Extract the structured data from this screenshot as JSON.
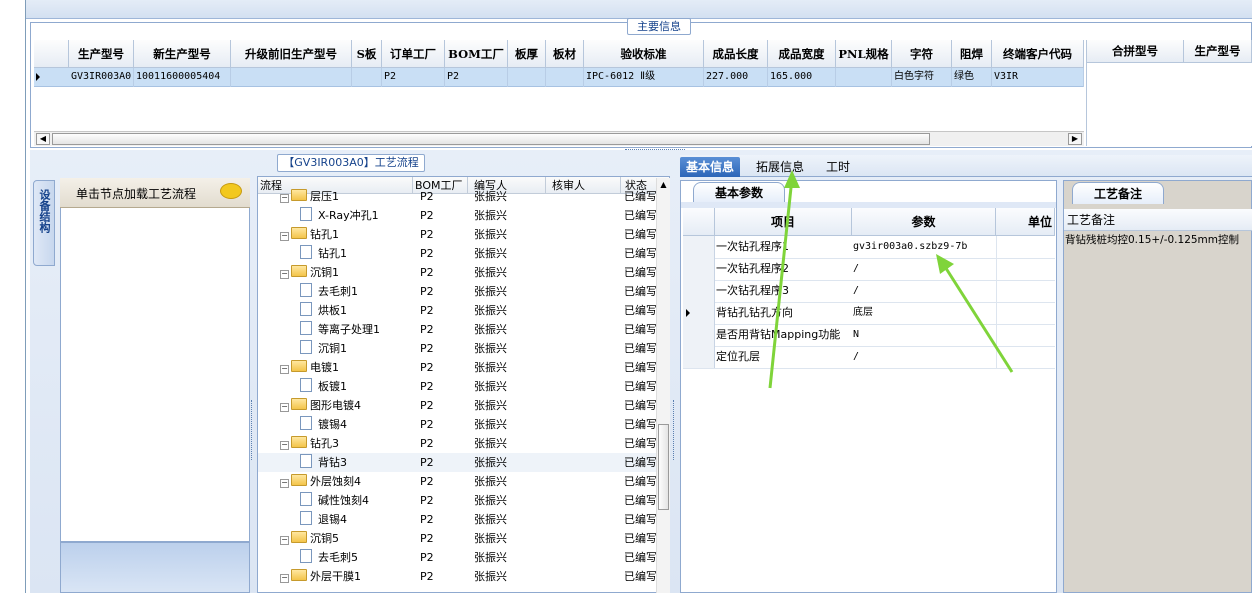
{
  "top": {
    "section_title": "主要信息",
    "columns": [
      "生产型号",
      "新生产型号",
      "升级前旧生产型号",
      "S板",
      "订单工厂",
      "BOM工厂",
      "板厚",
      "板材",
      "验收标准",
      "成品长度",
      "成品宽度",
      "PNL规格",
      "字符",
      "阻焊",
      "终端客户代码"
    ],
    "row": [
      "GV3IR003A0",
      "10011600005404",
      "",
      "",
      "P2",
      "P2",
      "",
      "",
      "IPC-6012 Ⅱ级",
      "227.000",
      "165.000",
      "",
      "白色字符",
      "绿色",
      "V3IR"
    ],
    "right_columns": [
      "合拼型号",
      "生产型号"
    ]
  },
  "process": {
    "title": "【GV3IR003A0】工艺流程",
    "vertical_tab": "设备结构",
    "nav_hint": "单击节点加载工艺流程",
    "columns": [
      "流程",
      "BOM工厂",
      "编写人",
      "核审人",
      "状态"
    ],
    "rows": [
      {
        "name": "层压1",
        "level": 0,
        "factory": "P2",
        "writer": "张振兴",
        "reviewer": "",
        "status": "已编写"
      },
      {
        "name": "X-Ray冲孔1",
        "level": 1,
        "factory": "P2",
        "writer": "张振兴",
        "reviewer": "",
        "status": "已编写"
      },
      {
        "name": "钻孔1",
        "level": 0,
        "factory": "P2",
        "writer": "张振兴",
        "reviewer": "",
        "status": "已编写"
      },
      {
        "name": "钻孔1",
        "level": 1,
        "factory": "P2",
        "writer": "张振兴",
        "reviewer": "",
        "status": "已编写"
      },
      {
        "name": "沉铜1",
        "level": 0,
        "factory": "P2",
        "writer": "张振兴",
        "reviewer": "",
        "status": "已编写"
      },
      {
        "name": "去毛刺1",
        "level": 1,
        "factory": "P2",
        "writer": "张振兴",
        "reviewer": "",
        "status": "已编写"
      },
      {
        "name": "烘板1",
        "level": 1,
        "factory": "P2",
        "writer": "张振兴",
        "reviewer": "",
        "status": "已编写"
      },
      {
        "name": "等离子处理1",
        "level": 1,
        "factory": "P2",
        "writer": "张振兴",
        "reviewer": "",
        "status": "已编写"
      },
      {
        "name": "沉铜1",
        "level": 1,
        "factory": "P2",
        "writer": "张振兴",
        "reviewer": "",
        "status": "已编写"
      },
      {
        "name": "电镀1",
        "level": 0,
        "factory": "P2",
        "writer": "张振兴",
        "reviewer": "",
        "status": "已编写"
      },
      {
        "name": "板镀1",
        "level": 1,
        "factory": "P2",
        "writer": "张振兴",
        "reviewer": "",
        "status": "已编写"
      },
      {
        "name": "图形电镀4",
        "level": 0,
        "factory": "P2",
        "writer": "张振兴",
        "reviewer": "",
        "status": "已编写"
      },
      {
        "name": "镀锡4",
        "level": 1,
        "factory": "P2",
        "writer": "张振兴",
        "reviewer": "",
        "status": "已编写"
      },
      {
        "name": "钻孔3",
        "level": 0,
        "factory": "P2",
        "writer": "张振兴",
        "reviewer": "",
        "status": "已编写"
      },
      {
        "name": "背钻3",
        "level": 1,
        "factory": "P2",
        "writer": "张振兴",
        "reviewer": "",
        "status": "已编写"
      },
      {
        "name": "外层蚀刻4",
        "level": 0,
        "factory": "P2",
        "writer": "张振兴",
        "reviewer": "",
        "status": "已编写"
      },
      {
        "name": "碱性蚀刻4",
        "level": 1,
        "factory": "P2",
        "writer": "张振兴",
        "reviewer": "",
        "status": "已编写"
      },
      {
        "name": "退锡4",
        "level": 1,
        "factory": "P2",
        "writer": "张振兴",
        "reviewer": "",
        "status": "已编写"
      },
      {
        "name": "沉铜5",
        "level": 0,
        "factory": "P2",
        "writer": "张振兴",
        "reviewer": "",
        "status": "已编写"
      },
      {
        "name": "去毛刺5",
        "level": 1,
        "factory": "P2",
        "writer": "张振兴",
        "reviewer": "",
        "status": "已编写"
      },
      {
        "name": "外层干膜1",
        "level": 0,
        "factory": "P2",
        "writer": "张振兴",
        "reviewer": "",
        "status": "已编写"
      }
    ]
  },
  "detail": {
    "tabs": [
      "基本信息",
      "拓展信息",
      "工时"
    ],
    "basic_tab": "基本参数",
    "columns": [
      "项目",
      "参数",
      "单位"
    ],
    "rows": [
      {
        "item": "一次钻孔程序1",
        "param": "gv3ir003a0.szbz9-7b"
      },
      {
        "item": "一次钻孔程序2",
        "param": "/"
      },
      {
        "item": "一次钻孔程序3",
        "param": "/"
      },
      {
        "item": "背钻孔钻孔方向",
        "param": "底层"
      },
      {
        "item": "是否用背钻Mapping功能",
        "param": "N"
      },
      {
        "item": "定位孔层",
        "param": "/"
      }
    ],
    "remark_tab": "工艺备注",
    "remark_header": "工艺备注",
    "remark_text": "背钻残桩均控0.15+/-0.125mm控制"
  },
  "colors": {
    "accent": "#2c66b8",
    "selected_row": "#c9dff5",
    "arrow": "#7fd43a"
  }
}
